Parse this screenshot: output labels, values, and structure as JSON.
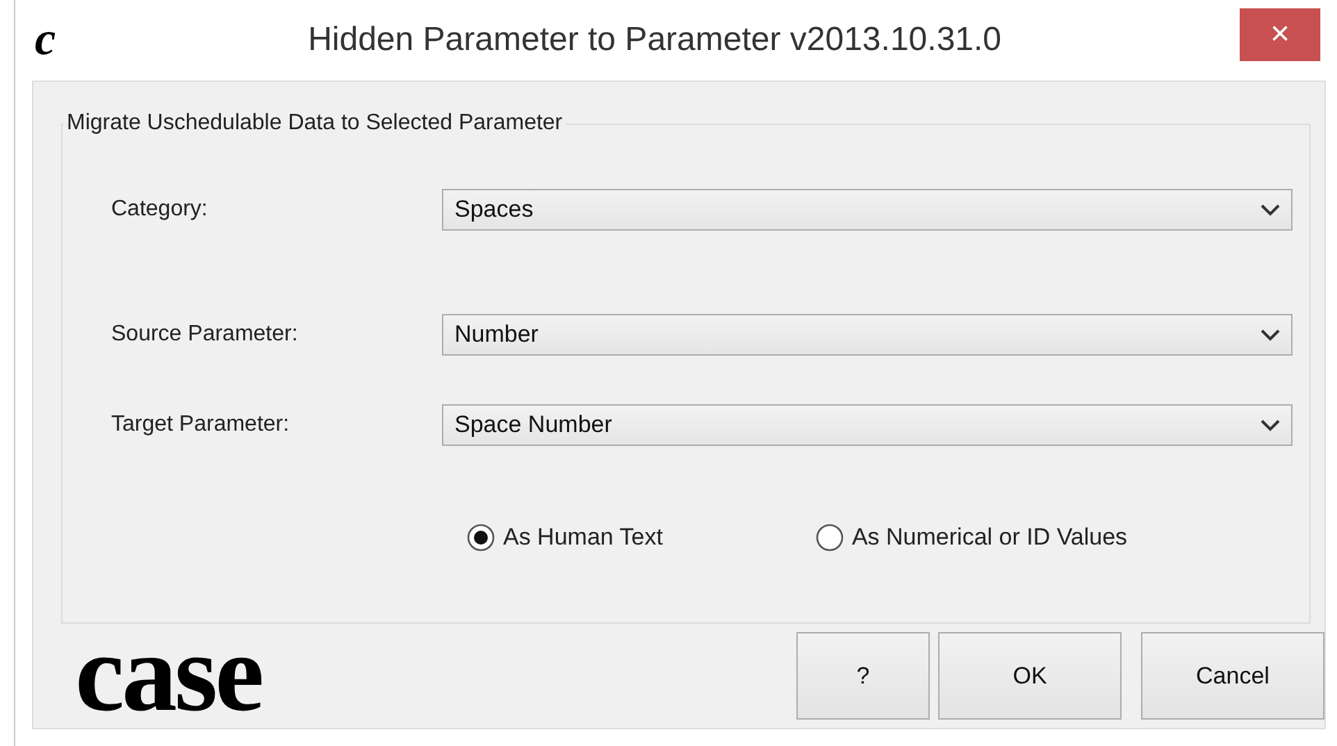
{
  "window": {
    "logo_letter": "c",
    "title": "Hidden Parameter to Parameter v2013.10.31.0",
    "close": "×"
  },
  "group": {
    "title": "Migrate Uschedulable Data to Selected Parameter",
    "fields": [
      {
        "label": "Category:",
        "value": "Spaces"
      },
      {
        "label": "Source Parameter:",
        "value": "Number"
      },
      {
        "label": "Target Parameter:",
        "value": "Space Number"
      }
    ],
    "options": [
      {
        "label": "As Human Text",
        "selected": true
      },
      {
        "label": "As Numerical or ID Values",
        "selected": false
      }
    ]
  },
  "logo": "case",
  "buttons": [
    "?",
    "OK",
    "Cancel"
  ]
}
